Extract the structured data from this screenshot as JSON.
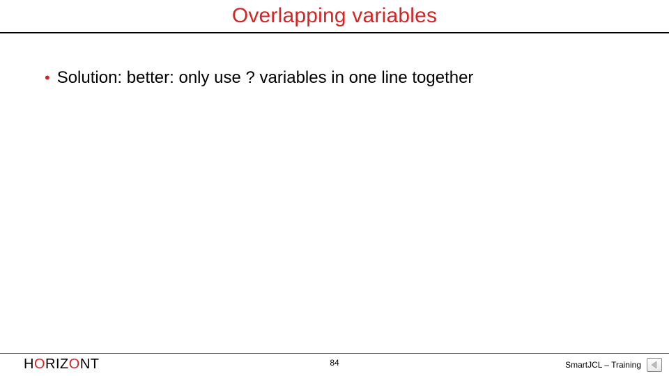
{
  "title": "Overlapping variables",
  "bullets": [
    "Solution: better: only use ? variables in one line together"
  ],
  "footer": {
    "brand_letters": [
      "H",
      "O",
      "R",
      "I",
      "Z",
      "O",
      "N",
      "T"
    ],
    "page_number": "84",
    "course": "SmartJCL – Training"
  },
  "colors": {
    "accent": "#d62423"
  }
}
